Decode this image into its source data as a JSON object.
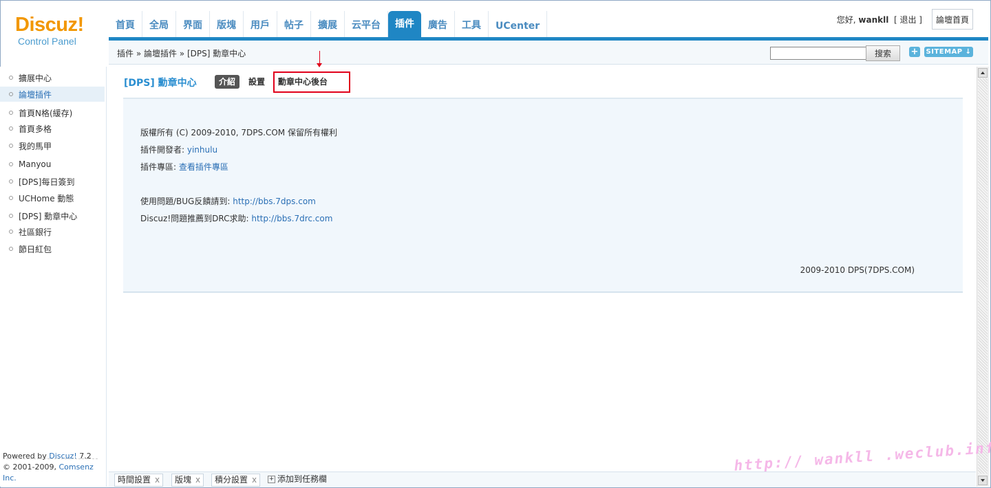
{
  "header": {
    "logo_main": "Discuz!",
    "logo_sub": "Control Panel",
    "greeting": "您好,",
    "username": "wankll",
    "logout": "[ 退出 ]",
    "home_button": "論壇首頁"
  },
  "nav": {
    "items": [
      {
        "label": "首頁"
      },
      {
        "label": "全局"
      },
      {
        "label": "界面"
      },
      {
        "label": "版塊"
      },
      {
        "label": "用戶"
      },
      {
        "label": "帖子"
      },
      {
        "label": "擴展"
      },
      {
        "label": "云平台"
      },
      {
        "label": "插件"
      },
      {
        "label": "廣告"
      },
      {
        "label": "工具"
      },
      {
        "label": "UCenter"
      }
    ],
    "active": "插件"
  },
  "breadcrumb": "插件 » 論壇插件 » [DPS] 勳章中心",
  "search": {
    "button": "搜索",
    "value": ""
  },
  "sitemap": {
    "plus": "+",
    "label": "SITEMAP ↓"
  },
  "sidebar": {
    "items": [
      {
        "label": "擴展中心"
      },
      {
        "label": "論壇插件"
      },
      {
        "label": "首頁N格(緩存)"
      },
      {
        "label": "首頁多格"
      },
      {
        "label": "我的馬甲"
      },
      {
        "label": "Manyou"
      },
      {
        "label": "[DPS]每日簽到"
      },
      {
        "label": "UCHome 動態"
      },
      {
        "label": "[DPS] 勳章中心"
      },
      {
        "label": "社區銀行"
      },
      {
        "label": "節日紅包"
      }
    ],
    "active": "論壇插件",
    "powered_prefix": "Powered by",
    "powered_brand": "Discuz!",
    "powered_version": "7.2",
    "copyright_prefix": "© 2001-2009,",
    "copyright_company": "Comsenz Inc."
  },
  "main": {
    "plugin_title": "[DPS] 勳章中心",
    "tabs": {
      "intro": "介紹",
      "settings": "設置",
      "admin": "勳章中心後台"
    },
    "info": {
      "copyright": "版權所有 (C) 2009-2010, 7DPS.COM 保留所有權利",
      "developer_label": "插件開發者:",
      "developer_name": "yinhulu",
      "zone_label": "插件專區:",
      "zone_link": "查看插件專區",
      "bug_label": "使用問題/BUG反饋請到:",
      "bug_link": "http://bbs.7dps.com",
      "discuz_label": "Discuz!問題推薦到DRC求助:",
      "discuz_link": "http://bbs.7drc.com",
      "footer": "2009-2010 DPS(7DPS.COM)"
    }
  },
  "taskbar": {
    "items": [
      {
        "label": "時間設置"
      },
      {
        "label": "版塊"
      },
      {
        "label": "積分設置"
      }
    ],
    "close_symbol": "x",
    "add_label": "添加到任務欄",
    "add_symbol": "+"
  },
  "watermark": "http:// wankll .weclub.info",
  "colors": {
    "accent": "#1f86c4",
    "link": "#2a6fb5",
    "logo": "#f29700",
    "annotation": "#e0001a"
  }
}
